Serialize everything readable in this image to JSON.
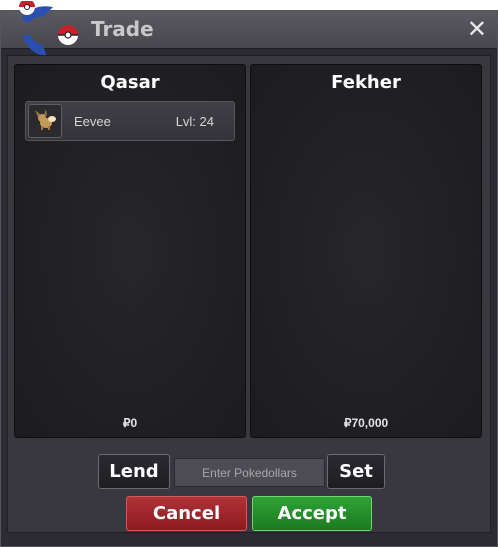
{
  "window": {
    "title": "Trade",
    "close_label": "✕"
  },
  "left_panel": {
    "player": "Qasar",
    "pokemon": [
      {
        "name": "Eevee",
        "level": "Lvl: 24",
        "icon": "eevee-icon"
      }
    ],
    "money": "₽0"
  },
  "right_panel": {
    "player": "Fekher",
    "money": "₽70,000"
  },
  "controls": {
    "lend_label": "Lend",
    "money_input_placeholder": "Enter Pokedollars",
    "set_label": "Set",
    "cancel_label": "Cancel",
    "accept_label": "Accept"
  },
  "colors": {
    "cancel": "#9e2329",
    "accept": "#24902a",
    "panel_bg": "#222226"
  }
}
